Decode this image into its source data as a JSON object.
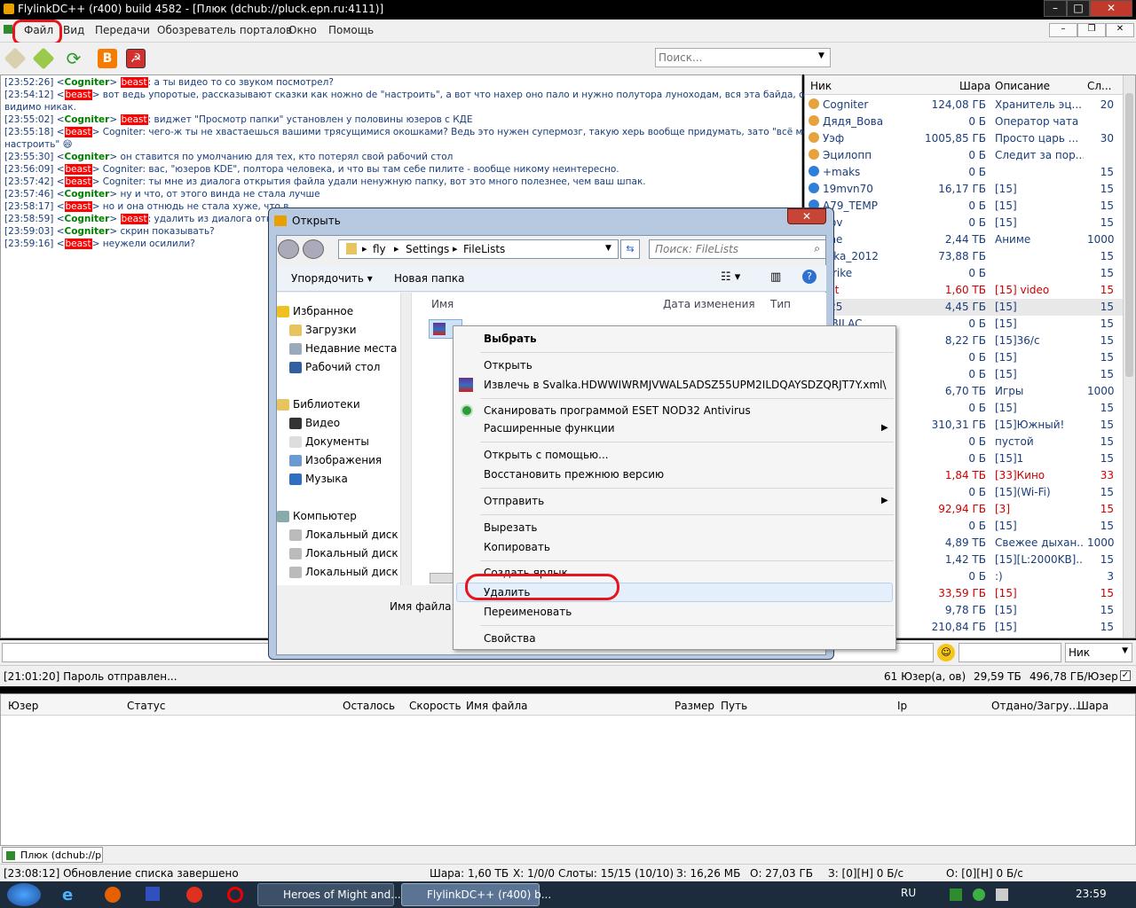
{
  "window": {
    "title": "FlylinkDC++ (r400) build 4582 - [Плюк (dchub://pluck.epn.ru:4111)]",
    "min": "–",
    "max": "□",
    "close": "✕"
  },
  "menu": [
    "Файл",
    "Вид",
    "Передачи",
    "Обозреватель порталов",
    "Окно",
    "Помощь"
  ],
  "search": {
    "placeholder": "Поиск..."
  },
  "chat": [
    {
      "time": "[23:52:26]",
      "nick": "Cogniter",
      "msg": " а ты видео то со звуком посмотрел?",
      "to": "beast"
    },
    {
      "time": "[23:54:12]",
      "nick": "beast",
      "msg": " вот ведь упоротые, рассказывают сказки как ножно de \"настроить\", а вот что нахер оно пало и нужно полутора луноходам, вся эта байда, осилить"
    },
    {
      "cont": "видимо никак."
    },
    {
      "time": "[23:55:02]",
      "nick": "Cogniter",
      "msg": " виджет \"Просмотр папки\" установлен у половины юзеров с КДЕ",
      "to": "beast"
    },
    {
      "time": "[23:55:18]",
      "nick": "beast",
      "msg": " Cogniter: чего-ж ты не хвастаешься вашими трясущимися окошками? Ведь это нужен супермозг, такую херь вообще придумать, зато \"всё можно"
    },
    {
      "cont": "настроить\" 😄"
    },
    {
      "time": "[23:55:30]",
      "nick": "Cogniter",
      "msg": " он ставится по умолчанию для тех, кто потерял свой рабочий стол"
    },
    {
      "time": "[23:56:09]",
      "nick": "beast",
      "msg": " Cogniter: вас, \"юзеров KDE\", полтора человека, и что вы там себе пилите - вообще никому неинтересно."
    },
    {
      "time": "[23:57:42]",
      "nick": "beast",
      "msg": " Cogniter: ты мне из диалога открытия файла удали ненужную папку, вот это много полезнее, чем ваш шпак."
    },
    {
      "time": "[23:57:46]",
      "nick": "Cogniter",
      "msg": " ну и что, от этого винда не стала лучше"
    },
    {
      "time": "[23:58:17]",
      "nick": "beast",
      "msg": " но и она отнюдь не стала хуже, что в"
    },
    {
      "time": "[23:58:59]",
      "nick": "Cogniter",
      "msg": " удалить из диалога открыти",
      "to": "beast"
    },
    {
      "time": "[23:59:03]",
      "nick": "Cogniter",
      "msg": " скрин показывать?"
    },
    {
      "time": "[23:59:16]",
      "nick": "beast",
      "msg": " неужели осилили?"
    }
  ],
  "users": {
    "headers": [
      "Ник",
      "Шара",
      "Описание",
      "Сл..."
    ],
    "rows": [
      {
        "nick": "Cogniter",
        "share": "124,08 ГБ",
        "desc": "Хранитель эц...",
        "slots": "20",
        "op": true
      },
      {
        "nick": "Дядя_Вова",
        "share": "0 Б",
        "desc": "Оператор чата",
        "slots": "",
        "op": true
      },
      {
        "nick": "Уэф",
        "share": "1005,85 ГБ",
        "desc": "Просто царь ...",
        "slots": "30",
        "op": true
      },
      {
        "nick": "Эцилопп",
        "share": "0 Б",
        "desc": "Следит за пор...",
        "slots": "",
        "op": true
      },
      {
        "nick": "+maks",
        "share": "0 Б",
        "desc": "",
        "slots": "15"
      },
      {
        "nick": "19mvn70",
        "share": "16,17 ГБ",
        "desc": "[15]",
        "slots": "15"
      },
      {
        "nick": "A79_TEMP",
        "share": "0 Б",
        "desc": "[15]",
        "slots": "15"
      },
      {
        "nick": "irov",
        "share": "0 Б",
        "desc": "[15]",
        "slots": "15"
      },
      {
        "nick": "ime",
        "share": "2,44 ТБ",
        "desc": "Аниме",
        "slots": "1000"
      },
      {
        "nick": "utka_2012",
        "share": "73,88 ГБ",
        "desc": "",
        "slots": "15"
      },
      {
        "nick": "strike",
        "share": "0 Б",
        "desc": "",
        "slots": "15"
      },
      {
        "nick": "ast",
        "share": "1,60 ТБ",
        "desc": "[15] video",
        "slots": "15",
        "red": true
      },
      {
        "nick": "v25",
        "share": "4,45 ГБ",
        "desc": "[15]",
        "slots": "15",
        "sel": true
      },
      {
        "nick": "OBILAC",
        "share": "0 Б",
        "desc": "[15]",
        "slots": "15"
      },
      {
        "nick": "",
        "share": "8,22 ГБ",
        "desc": "[15]36/с",
        "slots": "15"
      },
      {
        "nick": "",
        "share": "0 Б",
        "desc": "[15]",
        "slots": "15"
      },
      {
        "nick": "",
        "share": "0 Б",
        "desc": "[15]",
        "slots": "15"
      },
      {
        "nick": "",
        "share": "6,70 ТБ",
        "desc": "Игры",
        "slots": "1000"
      },
      {
        "nick": "",
        "share": "0 Б",
        "desc": "[15]",
        "slots": "15"
      },
      {
        "nick": "",
        "share": "310,31 ГБ",
        "desc": "[15]Южный!",
        "slots": "15"
      },
      {
        "nick": "",
        "share": "0 Б",
        "desc": "пустой",
        "slots": "15"
      },
      {
        "nick": "",
        "share": "0 Б",
        "desc": "[15]1",
        "slots": "15"
      },
      {
        "nick": "",
        "share": "1,84 ТБ",
        "desc": "[33]Кино",
        "slots": "33",
        "red": true
      },
      {
        "nick": "",
        "share": "0 Б",
        "desc": "[15](Wi-Fi)",
        "slots": "15"
      },
      {
        "nick": "",
        "share": "92,94 ГБ",
        "desc": "[3]",
        "slots": "15",
        "red": true
      },
      {
        "nick": "",
        "share": "0 Б",
        "desc": "[15]",
        "slots": "15"
      },
      {
        "nick": "",
        "share": "4,89 ТБ",
        "desc": "Свежее дыхан...",
        "slots": "1000"
      },
      {
        "nick": "",
        "share": "1,42 ТБ",
        "desc": "[15][L:2000KB]...",
        "slots": "15"
      },
      {
        "nick": "",
        "share": "0 Б",
        "desc": ":)",
        "slots": "3"
      },
      {
        "nick": "",
        "share": "33,59 ГБ",
        "desc": "[15]",
        "slots": "15",
        "red": true
      },
      {
        "nick": "",
        "share": "9,78 ГБ",
        "desc": "[15]",
        "slots": "15"
      },
      {
        "nick": "",
        "share": "210,84 ГБ",
        "desc": "[15]",
        "slots": "15"
      }
    ]
  },
  "input": {
    "nick_select": "Ник"
  },
  "status": {
    "left": "[21:01:20] Пароль отправлен...",
    "users": "61 Юзер(а, ов)",
    "share": "29,59 ТБ",
    "per_user": "496,78 ГБ/Юзер"
  },
  "transfers": {
    "headers": [
      "Юзер",
      "Статус",
      "Осталось",
      "Скорость",
      "Имя файла",
      "Размер",
      "Путь",
      "Ip",
      "Отдано/Загру...",
      "Шара"
    ]
  },
  "hub_tab": "Плюк (dchub://pl...",
  "bottom_status": {
    "msg": "[23:08:12] Обновление списка завершено",
    "share": "Шара: 1,60 ТБ",
    "x": "X: 1/0/0",
    "slots": "Слоты: 15/15 (10/10)",
    "z": "З: 16,26 МБ",
    "o": "О: 27,03 ГБ",
    "zh": "З: [0][H] 0 Б/с",
    "oh": "О: [0][H] 0 Б/с"
  },
  "dialog": {
    "title": "Открыть",
    "path": [
      "fly",
      "Settings",
      "FileLists"
    ],
    "search_placeholder": "Поиск: FileLists",
    "organize": "Упорядочить ▾",
    "new_folder": "Новая папка",
    "col_name": "Имя",
    "col_date": "Дата изменения",
    "col_type": "Тип",
    "filename_label": "Имя файла:",
    "nav": {
      "favorites": "Избранное",
      "downloads": "Загрузки",
      "recent": "Недавние места",
      "desktop": "Рабочий стол",
      "libraries": "Библиотеки",
      "video": "Видео",
      "documents": "Документы",
      "images": "Изображения",
      "music": "Музыка",
      "computer": "Компьютер",
      "disk1": "Локальный диск",
      "disk2": "Локальный диск",
      "disk3": "Локальный диск"
    }
  },
  "context_menu": {
    "select": "Выбрать",
    "open": "Открыть",
    "extract": "Извлечь в Svalka.HDWWIWRMJVWAL5ADSZ55UPM2ILDQAYSDZQRJT7Y.xml\\",
    "scan": "Сканировать программой ESET NOD32 Antivirus",
    "advanced": "Расширенные функции",
    "open_with": "Открыть с помощью...",
    "restore": "Восстановить прежнюю версию",
    "send_to": "Отправить",
    "cut": "Вырезать",
    "copy": "Копировать",
    "shortcut": "Создать ярлык",
    "delete": "Удалить",
    "rename": "Переименовать",
    "properties": "Свойства"
  },
  "taskbar": {
    "task1": "Heroes of Might and...",
    "task2": "FlylinkDC++ (r400) b...",
    "lang": "RU",
    "clock": "23:59"
  },
  "colors": {
    "highlight_red": "#e8141b",
    "nick_red": "#cc0000",
    "op_green": "#008000"
  }
}
